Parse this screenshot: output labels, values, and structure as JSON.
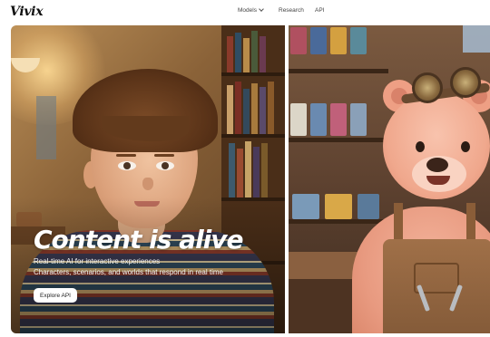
{
  "header": {
    "logo": "Vivix",
    "nav": {
      "models": "Models",
      "research": "Research",
      "api": "API"
    }
  },
  "hero": {
    "title": "Content is alive",
    "subtitle_line1": "Real-time AI for interactive experiences",
    "subtitle_line2": "Characters, scenarios, and worlds that respond in real time",
    "cta_label": "Explore API"
  },
  "images": {
    "left": "photo of a boy in a patterned sweater in a cozy library room",
    "right": "3D pink bear mechanic with goggles and overalls in a workshop"
  },
  "colors": {
    "background": "#ffffff",
    "text": "#222222",
    "hero_text": "#ffffff",
    "cta_background": "#ffffff"
  },
  "icons": {
    "models_dropdown": "chevron-down-icon"
  }
}
